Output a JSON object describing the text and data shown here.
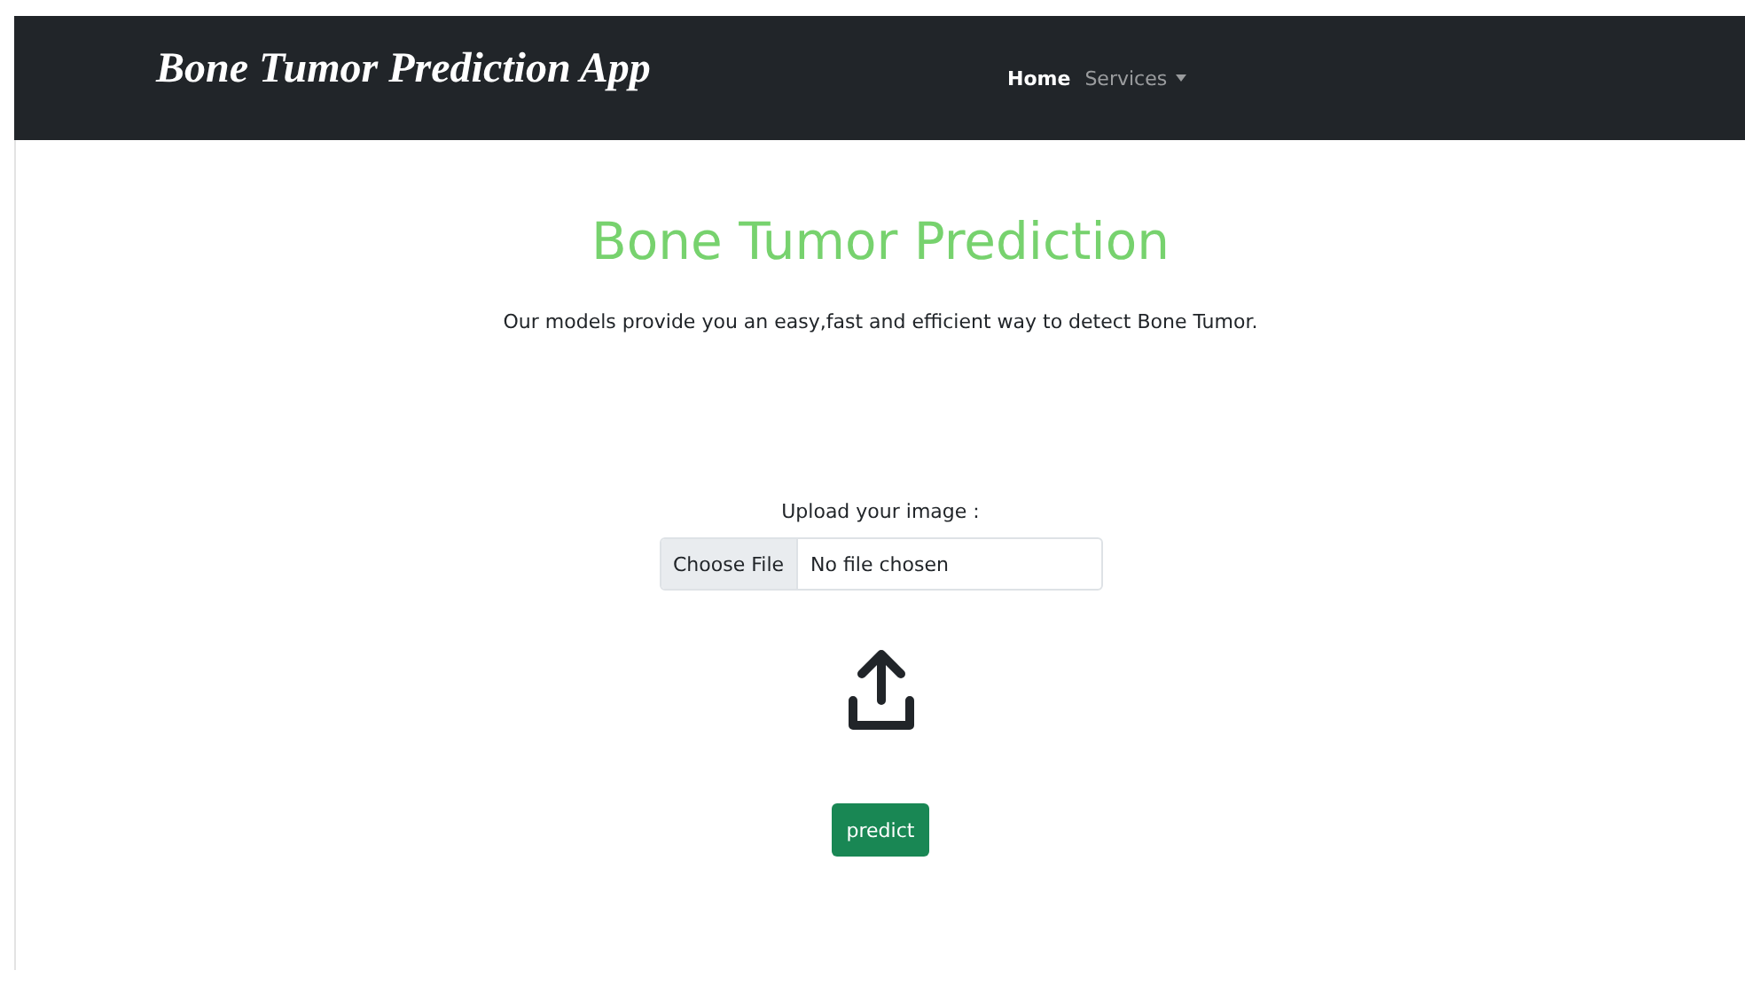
{
  "navbar": {
    "brand": "Bone Tumor Prediction App",
    "items": [
      {
        "label": "Home",
        "selected": true,
        "dropdown": false
      },
      {
        "label": "Services",
        "selected": false,
        "dropdown": true
      }
    ]
  },
  "hero": {
    "title": "Bone Tumor Prediction",
    "subtitle": "Our models provide you an easy,fast and efficient way to detect Bone Tumor."
  },
  "upload": {
    "label": "Upload your image :",
    "button": "Choose File",
    "status": "No file chosen"
  },
  "submit": "predict"
}
